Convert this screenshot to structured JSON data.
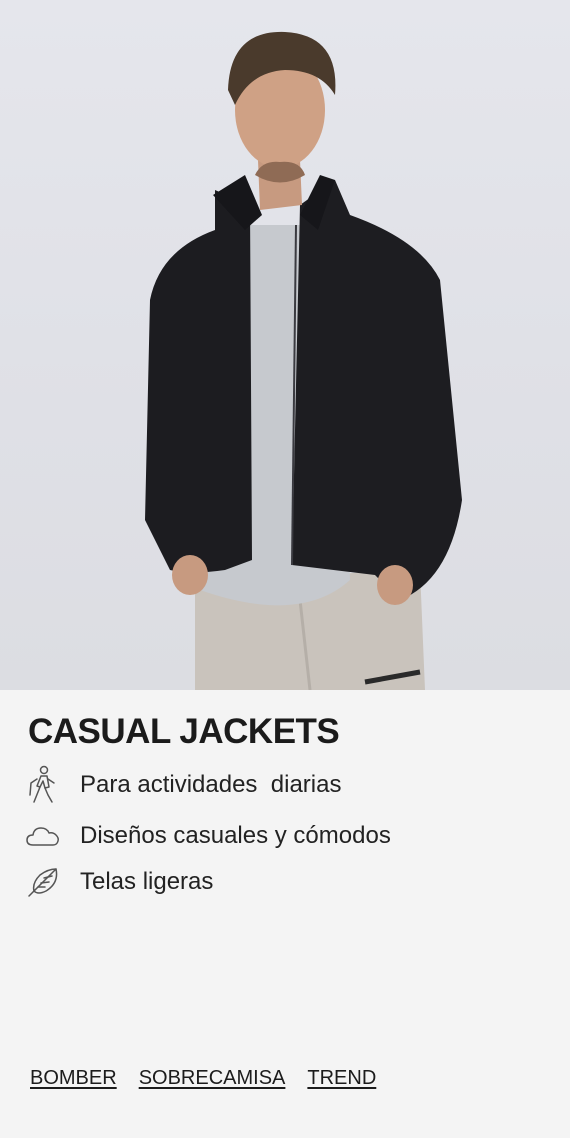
{
  "hero": {
    "image_icon": "person-wearing-black-fleece-jacket-photo"
  },
  "section": {
    "title": "CASUAL JACKETS"
  },
  "features": [
    {
      "icon": "hiker-icon",
      "label": "Para actividades  diarias"
    },
    {
      "icon": "cloud-icon",
      "label": "Diseños casuales y cómodos"
    },
    {
      "icon": "feather-icon",
      "label": "Telas ligeras"
    }
  ],
  "links": [
    {
      "label": "BOMBER"
    },
    {
      "label": "SOBRECAMISA"
    },
    {
      "label": "TREND"
    }
  ]
}
